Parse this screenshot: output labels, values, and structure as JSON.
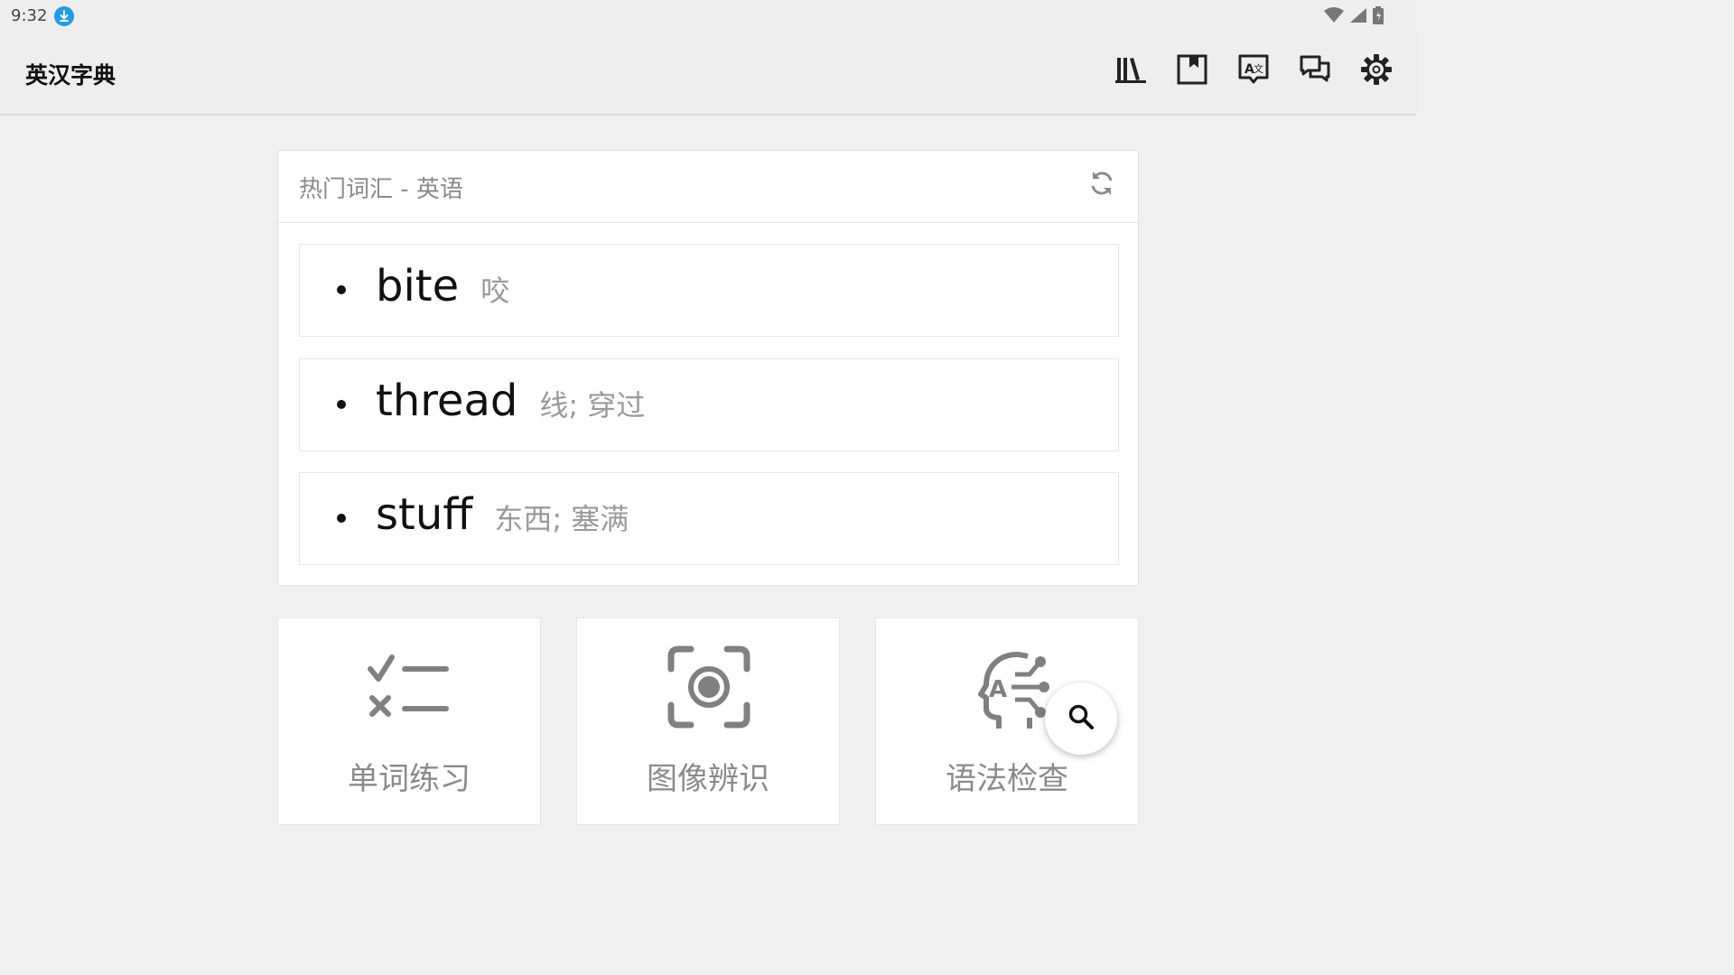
{
  "status_bar": {
    "time": "9:32"
  },
  "app_bar": {
    "title": "英汉字典",
    "actions": [
      "library-icon",
      "bookmark-icon",
      "translate-icon",
      "chat-icon",
      "settings-icon"
    ]
  },
  "hot_words": {
    "title": "热门词汇 - 英语",
    "items": [
      {
        "word": "bite",
        "meaning": "咬"
      },
      {
        "word": "thread",
        "meaning": "线; 穿过"
      },
      {
        "word": "stuff",
        "meaning": "东西; 塞满"
      }
    ]
  },
  "features": [
    {
      "label": "单词练习",
      "icon": "checklist-icon"
    },
    {
      "label": "图像辨识",
      "icon": "camera-scan-icon"
    },
    {
      "label": "语法检查",
      "icon": "ai-head-icon"
    }
  ],
  "fab": {
    "icon": "search-icon"
  },
  "colors": {
    "accent": "#1e9bf0",
    "icon_gray": "#808080",
    "background": "#f0f0f0"
  }
}
